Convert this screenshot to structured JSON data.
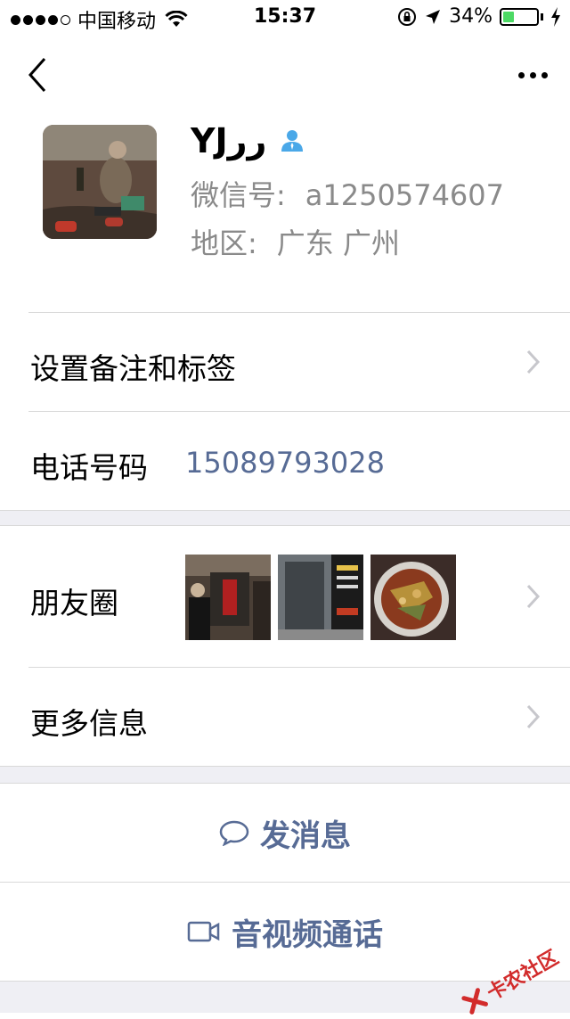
{
  "status_bar": {
    "carrier": "中国移动",
    "time": "15:37",
    "battery": "34%",
    "battery_level": 0.34,
    "icons": [
      "signal-dots",
      "wifi-icon",
      "rotation-lock-icon",
      "location-arrow-icon",
      "battery-icon",
      "charging-bolt-icon"
    ]
  },
  "nav": {
    "back_icon": "chevron-left-icon",
    "more_icon": "ellipsis-icon"
  },
  "profile": {
    "nickname": "YJرر",
    "wechat_id_label": "微信号:",
    "wechat_id": "a1250574607",
    "region_label": "地区:",
    "region": "广东 广州",
    "badge_icon": "contact-person-icon"
  },
  "rows": {
    "remarks_label": "设置备注和标签",
    "phone_label": "电话号码",
    "phone_value": "15089793028",
    "moments_label": "朋友圈",
    "more_info_label": "更多信息"
  },
  "actions": {
    "message_label": "发消息",
    "video_call_label": "音视频通话"
  },
  "watermark": {
    "text": "卡农社区"
  },
  "colors": {
    "link_blue": "#576b95",
    "separator": "#d9d9d9",
    "band_gray": "#efeff4",
    "battery_green": "#4cd964",
    "badge_blue": "#4aa8e8"
  }
}
